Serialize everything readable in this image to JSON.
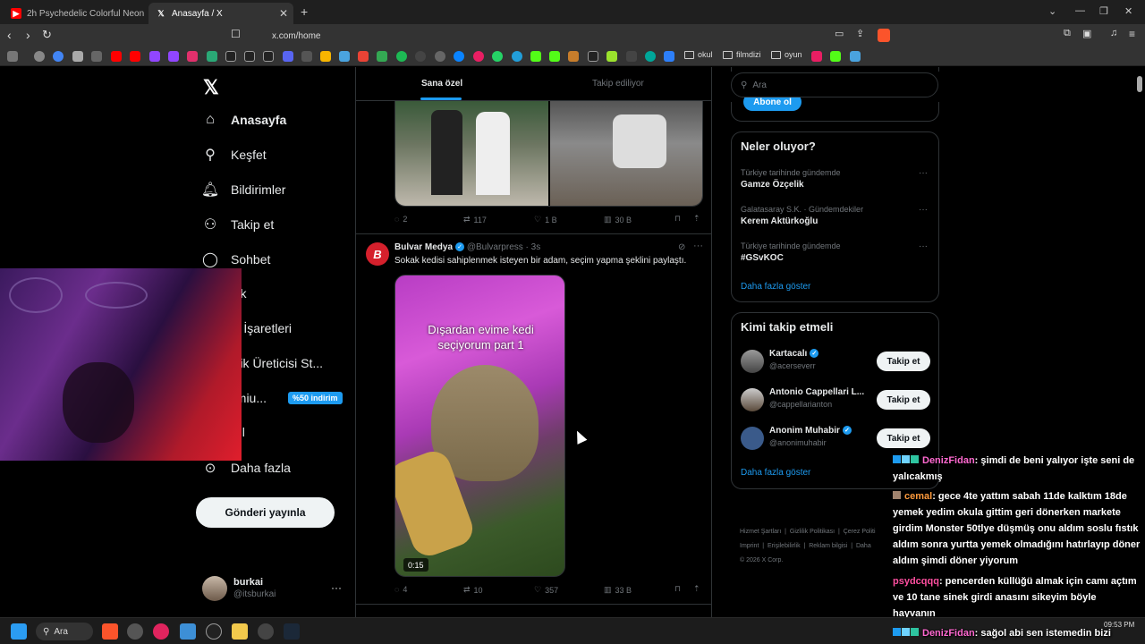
{
  "browser": {
    "tabs": [
      {
        "title": "2h Psychedelic Colorful Neon Backgr",
        "active": false
      },
      {
        "title": "Anasayfa / X",
        "active": true
      }
    ],
    "url": "x.com/home",
    "bookmark_folders": [
      "okul",
      "filmdizi",
      "oyun"
    ]
  },
  "sidebar": {
    "logo": "X",
    "items": [
      {
        "label": "Anasayfa",
        "icon": "home-icon"
      },
      {
        "label": "Keşfet",
        "icon": "search-icon"
      },
      {
        "label": "Bildirimler",
        "icon": "bell-icon"
      },
      {
        "label": "Takip et",
        "icon": "person-plus-icon"
      },
      {
        "label": "Sohbet",
        "icon": "chat-icon"
      },
      {
        "label": "rok",
        "icon": "grok-icon"
      },
      {
        "label": "er İşaretleri",
        "icon": "bookmark-icon"
      },
      {
        "label": "erik Üreticisi St...",
        "icon": "creator-icon"
      },
      {
        "label": "emiu...",
        "icon": "premium-icon"
      },
      {
        "label": "ofil",
        "icon": "profile-icon"
      },
      {
        "label": "Daha fazla",
        "icon": "more-icon"
      }
    ],
    "premium_badge": "%50 indirim",
    "post_button": "Gönderi yayınla",
    "account": {
      "name": "burkai",
      "handle": "@itsburkai"
    }
  },
  "timeline": {
    "tabs": [
      "Sana özel",
      "Takip ediliyor"
    ],
    "post1_actions": {
      "replies": "2",
      "reposts": "117",
      "likes": "1 B",
      "views": "30 B"
    },
    "post2": {
      "author": "Bulvar Medya",
      "handle": "@Bulvarpress",
      "time": "· 3s",
      "text": "Sokak kedisi sahiplenmek isteyen bir adam, seçim yapma şeklini paylaştı.",
      "video_caption": "Dışardan evime kedi seçiyorum part 1",
      "duration": "0:15",
      "replies": "4",
      "reposts": "10",
      "likes": "357",
      "views": "33 B"
    }
  },
  "right": {
    "search_placeholder": "Ara",
    "subscribe_label": "Abone ol",
    "trends_title": "Neler oluyor?",
    "trends": [
      {
        "meta": "Türkiye tarihinde gündemde",
        "name": "Gamze Özçelik"
      },
      {
        "meta": "Galatasaray S.K. · Gündemdekiler",
        "name": "Kerem Aktürkoğlu"
      },
      {
        "meta": "Türkiye tarihinde gündemde",
        "name": "#GSvKOC"
      }
    ],
    "show_more": "Daha fazla göster",
    "follow_title": "Kimi takip etmeli",
    "suggestions": [
      {
        "name": "Kartacalı",
        "handle": "@acerseverr",
        "button": "Takip et"
      },
      {
        "name": "Antonio Cappellari L...",
        "handle": "@cappellarianton",
        "button": "Takip et"
      },
      {
        "name": "Anonim Muhabir",
        "handle": "@anonimuhabir",
        "button": "Takip et"
      }
    ],
    "footer_links": [
      "Hizmet Şartları",
      "Gizlilik Politikası",
      "Çerez Politi",
      "Imprint",
      "Erişilebilirlik",
      "Reklam bilgisi",
      "Daha"
    ],
    "copyright": "© 2026 X Corp."
  },
  "chat": [
    {
      "user": "DenizFidan",
      "user_color": "#ff69d0",
      "text": ": şimdi de beni yalıyor işte seni de yalıcakmış"
    },
    {
      "user": "cemal",
      "user_color": "#ff9a3c",
      "text": ": gece 4te yattım sabah 11de kalktım 18de yemek yedim okula gittim geri dönerken markete girdim Monster 50tlye düşmüş onu aldım soslu fıstık aldım sonra yurtta yemek olmadığını hatırlayıp döner aldım şimdi döner yiyorum"
    },
    {
      "user": "psydcqqq",
      "user_color": "#ff4fa0",
      "text": ": pencerden küllüğü almak için camı açtım ve 10 tane sinek girdi anasını sikeyim böyle hayvanın"
    },
    {
      "user": "DenizFidan",
      "user_color": "#ff69d0",
      "text": ": sağol abi sen istemedin bizi"
    }
  ],
  "taskbar": {
    "search": "Ara",
    "time": "09:53 PM"
  }
}
